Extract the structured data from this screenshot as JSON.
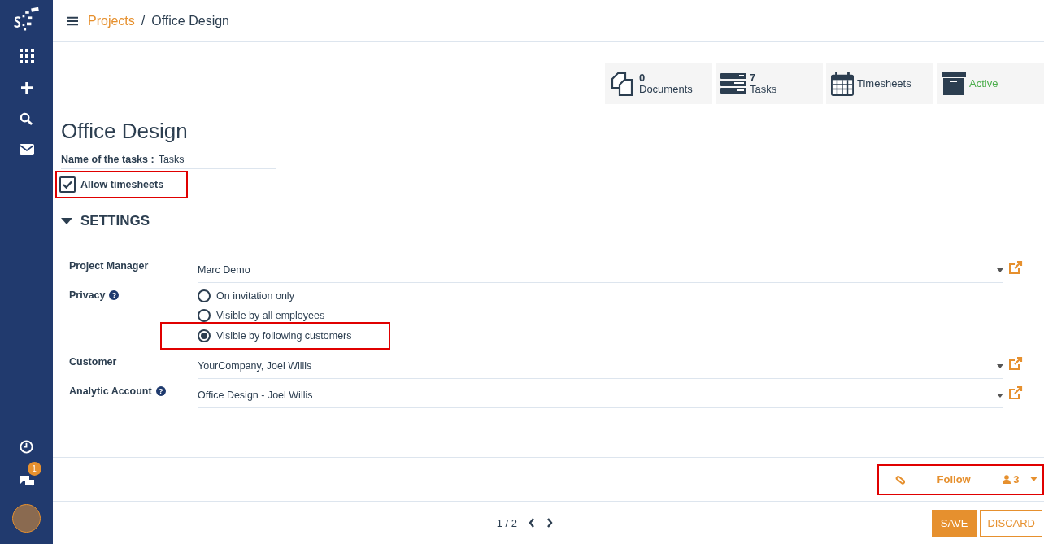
{
  "sidebar": {
    "notification_badge": "1"
  },
  "breadcrumb": {
    "parent": "Projects",
    "separator": "/",
    "current": "Office Design"
  },
  "stat_buttons": [
    {
      "kind": "documents",
      "count": "0",
      "label": "Documents"
    },
    {
      "kind": "tasks",
      "count": "7",
      "label": "Tasks"
    },
    {
      "kind": "timesheets",
      "label": "Timesheets"
    },
    {
      "kind": "status",
      "label": "Active"
    }
  ],
  "title": "Office Design",
  "task_name": {
    "label": "Name of the tasks :",
    "value": "Tasks"
  },
  "allow_timesheets": {
    "label": "Allow timesheets",
    "checked": true,
    "highlighted": true
  },
  "settings": {
    "title": "SETTINGS",
    "expanded": true,
    "project_manager": {
      "label": "Project Manager",
      "value": "Marc Demo"
    },
    "privacy": {
      "label": "Privacy",
      "help": "?",
      "options": [
        {
          "label": "On invitation only",
          "selected": false,
          "highlighted": false
        },
        {
          "label": "Visible by all employees",
          "selected": false,
          "highlighted": false
        },
        {
          "label": "Visible by following customers",
          "selected": true,
          "highlighted": true
        }
      ]
    },
    "customer": {
      "label": "Customer",
      "value": "YourCompany, Joel Willis"
    },
    "analytic_account": {
      "label": "Analytic Account",
      "help": "?",
      "value": "Office Design - Joel Willis"
    }
  },
  "follow": {
    "label": "Follow",
    "followers": "3",
    "highlighted": true
  },
  "pager": {
    "value": "1 / 2"
  },
  "buttons": {
    "save": "SAVE",
    "discard": "DISCARD"
  }
}
